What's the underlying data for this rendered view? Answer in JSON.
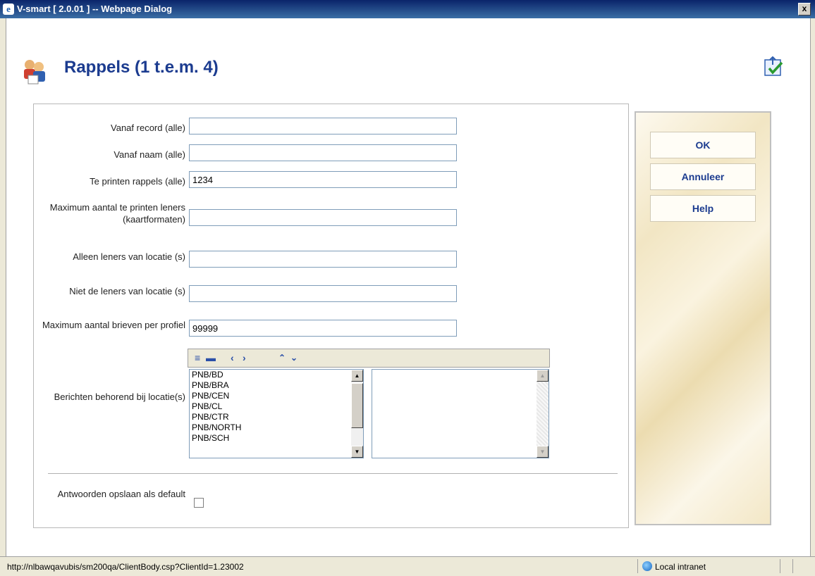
{
  "window": {
    "title": "V-smart [ 2.0.01 ] -- Webpage Dialog",
    "close_label": "x"
  },
  "page": {
    "title": "Rappels (1 t.e.m. 4)"
  },
  "form": {
    "fields": [
      {
        "label": "Vanaf record (alle)",
        "value": ""
      },
      {
        "label": "Vanaf naam (alle)",
        "value": ""
      },
      {
        "label": "Te printen rappels (alle)",
        "value": "1234"
      },
      {
        "label": "Maximum aantal te printen leners (kaartformaten)",
        "value": ""
      },
      {
        "label": "Alleen leners van locatie (s)",
        "value": ""
      },
      {
        "label": "Niet de leners van locatie (s)",
        "value": ""
      },
      {
        "label": "Maximum aantal brieven per profiel",
        "value": "99999"
      }
    ],
    "locations_label": "Berichten behorend bij locatie(s)",
    "locations": [
      "PNB/BD",
      "PNB/BRA",
      "PNB/CEN",
      "PNB/CL",
      "PNB/CTR",
      "PNB/NORTH",
      "PNB/SCH"
    ],
    "toolbar_icons": [
      "select-all-icon",
      "deselect-all-icon",
      "move-left-icon",
      "move-right-icon",
      "move-up-icon",
      "move-down-icon"
    ],
    "save_default_label": "Antwoorden opslaan als default",
    "save_default_checked": false
  },
  "buttons": {
    "ok": "OK",
    "cancel": "Annuleer",
    "help": "Help"
  },
  "statusbar": {
    "url": "http://nlbawqavubis/sm200qa/ClientBody.csp?ClientId=1.23002",
    "zone": "Local intranet"
  }
}
